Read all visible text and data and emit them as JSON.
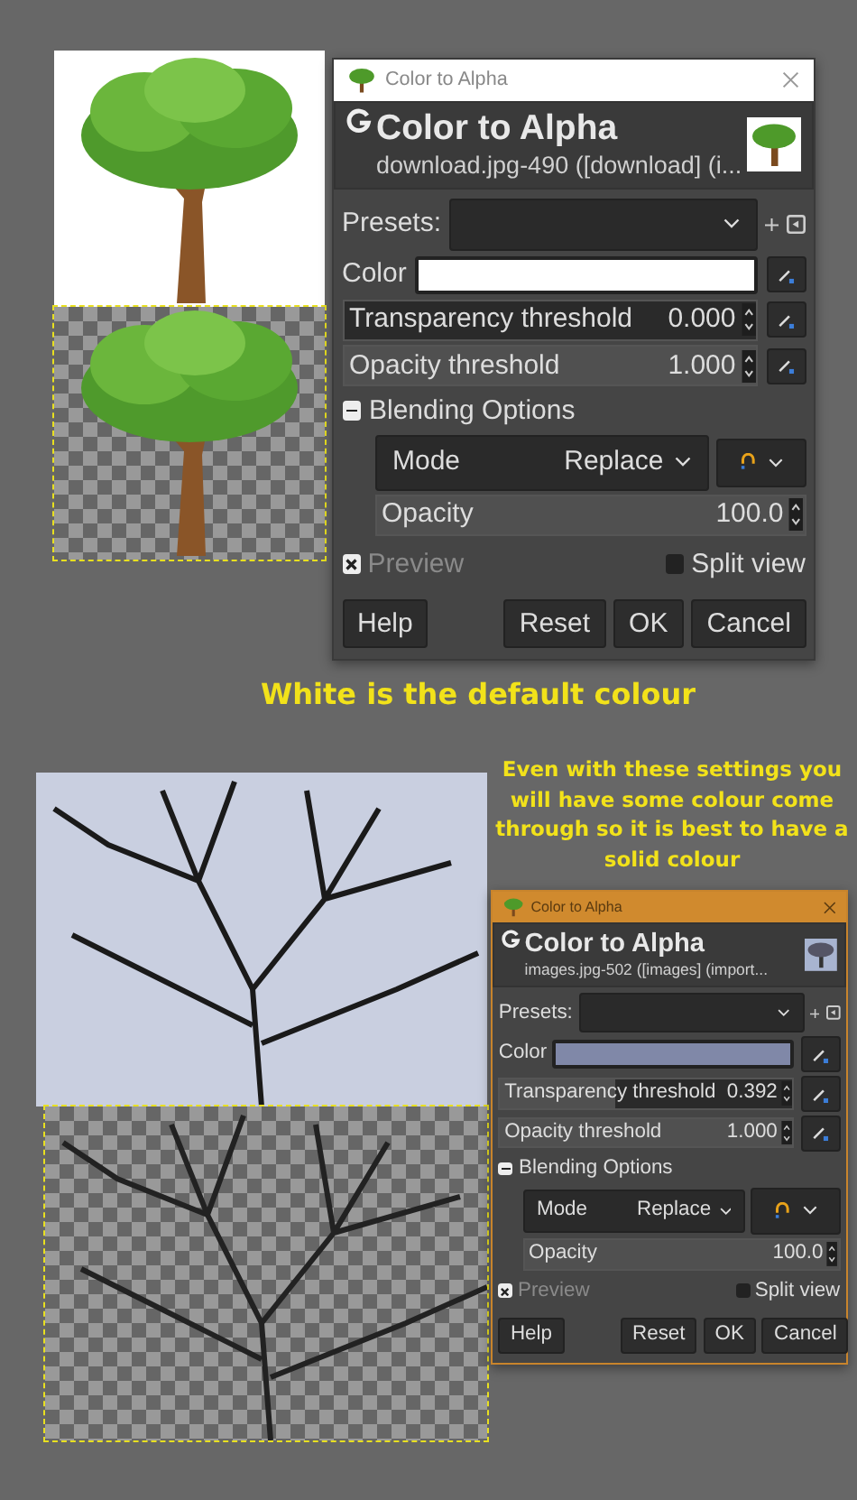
{
  "examples": [
    {
      "kind": "clipart",
      "dialog": {
        "window_title": "Color to Alpha",
        "active": false,
        "heading": "Color to Alpha",
        "subtitle": "download.jpg-490 ([download] (i...",
        "presets_label": "Presets:",
        "color_label": "Color",
        "color": "#ffffff",
        "thresholds": [
          {
            "label": "Transparency threshold",
            "value": "0.000",
            "level": 0
          },
          {
            "label": "Opacity threshold",
            "value": "1.000",
            "level": 1
          }
        ],
        "blending": {
          "label": "Blending Options",
          "expanded": true,
          "mode_label": "Mode",
          "mode_value": "Replace",
          "opacity": {
            "label": "Opacity",
            "value": "100.0",
            "level": 1
          }
        },
        "preview": {
          "label": "Preview",
          "checked": true,
          "disabled": true
        },
        "split_view": {
          "label": "Split view",
          "checked": false
        },
        "buttons": [
          "Help",
          "Reset",
          "OK",
          "Cancel"
        ]
      },
      "caption": "White is the default colour"
    },
    {
      "kind": "photo",
      "caption": "Even with these settings you will have some colour come through so it is best to have a solid colour",
      "dialog": {
        "window_title": "Color to Alpha",
        "active": true,
        "heading": "Color to Alpha",
        "subtitle": "images.jpg-502 ([images] (import...",
        "presets_label": "Presets:",
        "color_label": "Color",
        "color": "#8088a8",
        "thresholds": [
          {
            "label": "Transparency threshold",
            "value": "0.392",
            "level": 0.392
          },
          {
            "label": "Opacity threshold",
            "value": "1.000",
            "level": 1
          }
        ],
        "blending": {
          "label": "Blending Options",
          "expanded": true,
          "mode_label": "Mode",
          "mode_value": "Replace",
          "opacity": {
            "label": "Opacity",
            "value": "100.0",
            "level": 1
          }
        },
        "preview": {
          "label": "Preview",
          "checked": true,
          "disabled": true
        },
        "split_view": {
          "label": "Split view",
          "checked": false
        },
        "buttons": [
          "Help",
          "Reset",
          "OK",
          "Cancel"
        ]
      }
    }
  ]
}
